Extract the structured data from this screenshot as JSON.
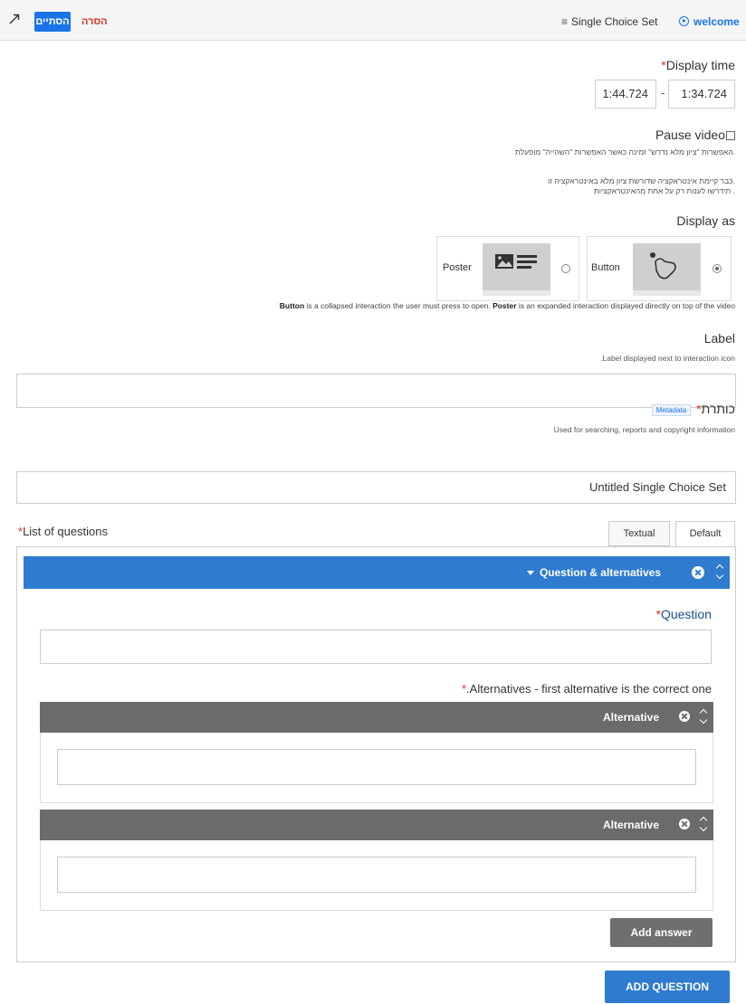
{
  "topbar": {
    "finish_label": "הסתיים",
    "remove_label": "הסרה",
    "content_type_label": "Single Choice Set",
    "welcome_label": "welcome"
  },
  "display_time": {
    "label": "Display time",
    "required_mark": "*",
    "end_value": "1:44.724",
    "separator": "-",
    "start_value": "1:34.724"
  },
  "pause_video": {
    "label": "Pause video",
    "checked": false,
    "note_line1": "האפשרות \"ציון מלא נדרש\" זמינה כאשר האפשרות \"השהייה\" מופעלת.",
    "note_line2": "כבר קיימת אינטראקציה שדורשת ציון מלא באינטראקציה זו.",
    "note_line3": "תידרשו לענות רק על אחת מהאינטראקציות ."
  },
  "display_as": {
    "label": "Display as",
    "options": [
      {
        "label": "Button",
        "selected": true
      },
      {
        "label": "Poster",
        "selected": false
      }
    ],
    "help_bold1": "Button",
    "help_text1": " is a collapsed interaction the user must press to open. ",
    "help_bold2": "Poster",
    "help_text2": " is an expanded interaction displayed directly on top of the video"
  },
  "label_field": {
    "label": "Label",
    "help": ".Label displayed next to interaction icon",
    "value": ""
  },
  "title_field": {
    "label": "כותרת",
    "required_mark": "*",
    "metadata_tag": "Metadata",
    "help": "Used for searching, reports and copyright information",
    "value": "Untitled Single Choice Set"
  },
  "questions": {
    "label": "List of questions",
    "required_mark": "*",
    "tabs": [
      "Textual",
      "Default"
    ],
    "active_tab": "Default",
    "group_title": "Question & alternatives",
    "question_label": "Question",
    "question_value": "",
    "alternatives_label": ".Alternatives - first alternative is the correct one",
    "alternatives": [
      {
        "title": "Alternative",
        "value": ""
      },
      {
        "title": "Alternative",
        "value": ""
      }
    ],
    "add_answer_label": "Add answer",
    "add_question_label": "ADD QUESTION"
  },
  "colors": {
    "primary_blue": "#2e7bcf",
    "finish_blue": "#1a73e8",
    "required_red": "#d93025",
    "alt_header_gray": "#6b6b6b"
  }
}
